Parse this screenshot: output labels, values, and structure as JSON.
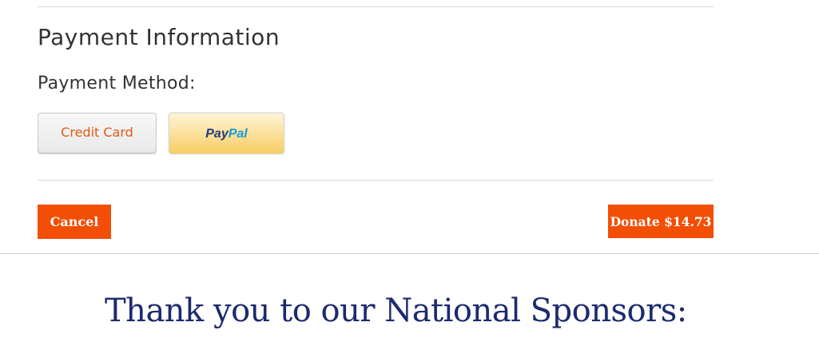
{
  "payment_section": {
    "title": "Payment Information",
    "method_label": "Payment Method:",
    "methods": {
      "credit_card_label": "Credit Card",
      "paypal_logo_text_pay": "Pay",
      "paypal_logo_text_pal": "Pal"
    }
  },
  "actions": {
    "cancel_label": "Cancel",
    "donate_label": "Donate $14.73"
  },
  "sponsors": {
    "heading": "Thank you to our National Sponsors:"
  },
  "colors": {
    "accent": "#f24e06",
    "heading_navy": "#1c2a6e",
    "credit_card_text": "#e05a14",
    "paypal_dark_blue": "#253b80",
    "paypal_light_blue": "#179bd7"
  }
}
